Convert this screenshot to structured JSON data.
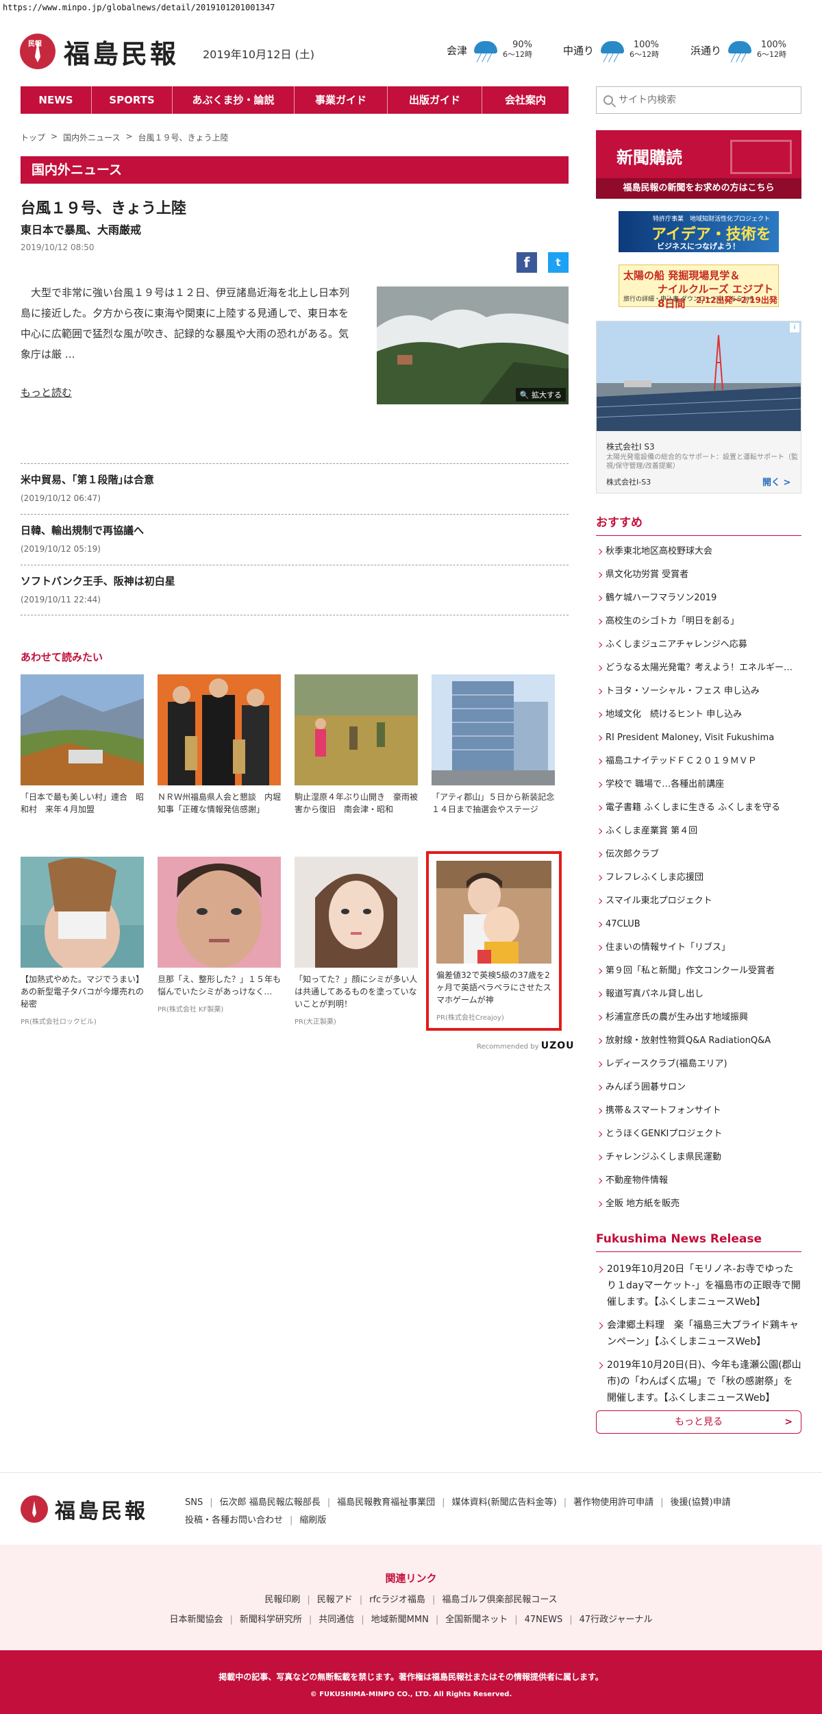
{
  "url": "https://www.minpo.jp/globalnews/detail/2019101201001347",
  "header": {
    "logo_mark": "民報",
    "logo_text": "福島民報",
    "date": "2019年10月12日 (土)",
    "weather": [
      {
        "area": "会津",
        "pct": "90%",
        "time": "6〜12時"
      },
      {
        "area": "中通り",
        "pct": "100%",
        "time": "6〜12時"
      },
      {
        "area": "浜通り",
        "pct": "100%",
        "time": "6〜12時"
      }
    ]
  },
  "nav": [
    {
      "label": "NEWS"
    },
    {
      "label": "SPORTS"
    },
    {
      "label": "あぶくま抄・論説"
    },
    {
      "label": "事業ガイド"
    },
    {
      "label": "出版ガイド"
    },
    {
      "label": "会社案内"
    }
  ],
  "search": {
    "placeholder": "サイト内検索"
  },
  "breadcrumb": [
    "トップ",
    ">",
    "国内外ニュース",
    ">",
    "台風１９号、きょう上陸"
  ],
  "article": {
    "section": "国内外ニュース",
    "title": "台風１９号、きょう上陸",
    "subtitle": "東日本で暴風、大雨厳戒",
    "date": "2019/10/12 08:50",
    "lead": "　大型で非常に強い台風１９号は１２日、伊豆諸島近海を北上し日本列島に接近した。夕方から夜に東海や関東に上陸する見通しで、東日本を中心に広範囲で猛烈な風が吹き、記録的な暴風や大雨の恐れがある。気象庁は厳 …",
    "more_label": "もっと読む",
    "zoom_label": "拡大する",
    "share_fb": "f",
    "share_tw": "t"
  },
  "news": [
    {
      "title": "米中貿易、｢第１段階｣は合意",
      "date": "(2019/10/12 06:47)"
    },
    {
      "title": "日韓、輸出規制で再協議へ",
      "date": "(2019/10/12 05:19)"
    },
    {
      "title": "ソフトバンク王手、阪神は初白星",
      "date": "(2019/10/11 22:44)"
    }
  ],
  "related": {
    "title": "あわせて読みたい",
    "cards": [
      {
        "text": "「日本で最も美しい村」連合　昭和村　来年４月加盟",
        "pr": ""
      },
      {
        "text": "ＮＲＷ州福島県人会と懇談　内堀知事「正確な情報発信感謝」",
        "pr": ""
      },
      {
        "text": "駒止湿原４年ぶり山開き　豪雨被害から復旧　南会津・昭和",
        "pr": ""
      },
      {
        "text": "「アティ郡山」５日から新装記念　１４日まで抽選会やステージ",
        "pr": ""
      },
      {
        "text": "【加熱式やめた。マジでうまい】あの新型電子タバコが今爆売れの秘密",
        "pr": "PR(株式会社ロックビル)"
      },
      {
        "text": "旦那「え、整形した？」１５年も悩んでいたシミがあっけなく…",
        "pr": "PR(株式会社 KF製薬)"
      },
      {
        "text": "「知ってた？」顔にシミが多い人は共通してあるものを塗っていないことが判明！",
        "pr": "PR(大正製薬)"
      },
      {
        "text": "偏差値32で英検5級の37歳を2ヶ月で英語ペラペラにさせたスマホゲームが神",
        "pr": "PR(株式会社Creajoy)"
      }
    ],
    "recommended_by": "Recommended by",
    "recommended_brand": "UZOU"
  },
  "sidebar": {
    "subscribe": {
      "title": "新聞購読",
      "sub": "福島民報の新聞をお求めの方はこちら"
    },
    "ad_idea": {
      "t1": "特許庁事業　地域知財活性化プロジェクト",
      "t2": "アイデア・技術を",
      "t3": "ビジネスにつなげよう！"
    },
    "ad_ship": {
      "t1": "太陽の船 発掘現場見学＆",
      "t2": "ナイルクルーズ エジプト8日間",
      "t3": "旅行の詳細・申込書 ダウンロードはこちらから",
      "t4": "2/12出発〜2/19出発"
    },
    "ad_solar": {
      "name": "株式会社I S3",
      "desc": "太陽光発電設備の総合的なサポート：設置と運転サポート（監視/保守管理/改善提案）",
      "brand": "株式会社I-S3",
      "open": "開く >",
      "info": "i"
    },
    "recommend_title": "おすすめ",
    "recommend": [
      "秋季東北地区高校野球大会",
      "県文化功労賞 受賞者",
      "鶴ケ城ハーフマラソン2019",
      "高校生のシゴトカ「明日を創る」",
      "ふくしまジュニアチャレンジへ応募",
      "どうなる太陽光発電？考えよう！エネルギー…",
      "トヨタ・ソーシャル・フェス 申し込み",
      "地域文化　続けるヒント 申し込み",
      "RI President Maloney, Visit Fukushima",
      "福島ユナイテッドＦＣ２０１９ＭＶＰ",
      "学校で 職場で…各種出前講座",
      "電子書籍 ふくしまに生きる ふくしまを守る",
      "ふくしま産業賞 第４回",
      "伝次郎クラブ",
      "フレフレふくしま応援団",
      "スマイル東北プロジェクト",
      "47CLUB",
      "住まいの情報サイト「リブス」",
      "第９回「私と新聞」作文コンクール受賞者",
      "報道写真パネル貸し出し",
      "杉浦宣彦氏の農が生み出す地域振興",
      "放射線・放射性物質Q&A RadiationQ&A",
      "レディースクラブ(福島エリア)",
      "みんぽう囲碁サロン",
      "携帯＆スマートフォンサイト",
      "とうほくGENKIプロジェクト",
      "チャレンジふくしま県民運動",
      "不動産物件情報",
      "全販 地方紙を販売"
    ],
    "fnr_title": "Fukushima News Release",
    "fnr": [
      "2019年10月20日「モリノネ-お寺でゆったり１dayマーケット-」を福島市の正眼寺で開催します。【ふくしまニュースWeb】",
      "会津郷土料理　楽「福島三大プライド鶏キャンペーン」【ふくしまニュースWeb】",
      "2019年10月20日(日)、今年も逢瀬公園(郡山市)の「わんぱく広場」で「秋の感謝祭」を開催します。【ふくしまニュースWeb】"
    ],
    "more_label": "もっと見る",
    "more_arrow": ">"
  },
  "footer": {
    "links_row1": [
      "SNS",
      "伝次郎 福島民報広報部長",
      "福島民報教育福祉事業団",
      "媒体資料(新聞広告料金等)",
      "著作物使用許可申請",
      "後援(協賛)申請"
    ],
    "links_row2": [
      "投稿・各種お問い合わせ",
      "縮刷版"
    ],
    "related_title": "関連リンク",
    "related_row1": [
      "民報印刷",
      "民報アド",
      "rfcラジオ福島",
      "福島ゴルフ倶楽部民報コース"
    ],
    "related_row2": [
      "日本新聞協会",
      "新聞科学研究所",
      "共同通信",
      "地域新聞MMN",
      "全国新聞ネット",
      "47NEWS",
      "47行政ジャーナル"
    ],
    "copyright1": "掲載中の記事、写真などの無断転載を禁じます。著作権は福島民報社またはその情報提供者に属します。",
    "copyright2": "© FUKUSHIMA-MINPO CO., LTD. All Rights Reserved."
  }
}
